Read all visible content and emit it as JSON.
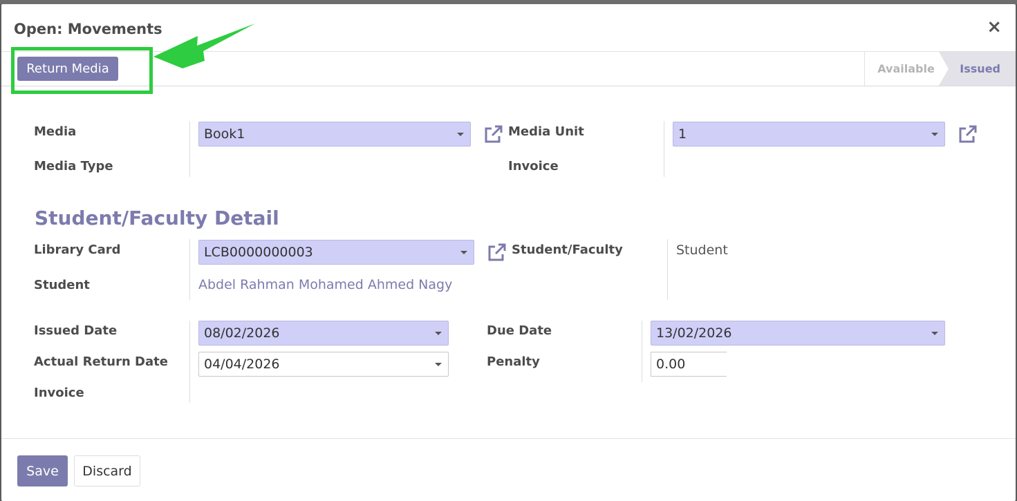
{
  "dialog": {
    "title": "Open: Movements",
    "close_glyph": "×"
  },
  "header": {
    "return_button": "Return Media",
    "stages": [
      "Available",
      "Issued"
    ],
    "active_stage": "Issued"
  },
  "media": {
    "media_label": "Media",
    "media_value": "Book1",
    "media_unit_label": "Media Unit",
    "media_unit_value": "1",
    "media_type_label": "Media Type",
    "invoice_label": "Invoice"
  },
  "student_section": {
    "title": "Student/Faculty Detail",
    "library_card_label": "Library Card",
    "library_card_value": "LCB0000000003",
    "student_faculty_label": "Student/Faculty",
    "student_faculty_value": "Student",
    "student_label": "Student",
    "student_value": "Abdel Rahman Mohamed Ahmed Nagy"
  },
  "dates": {
    "issued_date_label": "Issued Date",
    "issued_date_value": "08/02/2026",
    "due_date_label": "Due Date",
    "due_date_value": "13/02/2026",
    "actual_return_label": "Actual Return Date",
    "actual_return_value": "04/04/2026",
    "penalty_label": "Penalty",
    "penalty_value": "0.00",
    "invoice_label": "Invoice"
  },
  "footer": {
    "save_label": "Save",
    "discard_label": "Discard"
  },
  "colors": {
    "primary": "#7c7bad",
    "highlight": "#2ecc40",
    "required_field": "#cfcff8"
  },
  "icons": [
    "close-icon",
    "external-link-icon",
    "caret-down-icon",
    "annotation-arrow"
  ]
}
